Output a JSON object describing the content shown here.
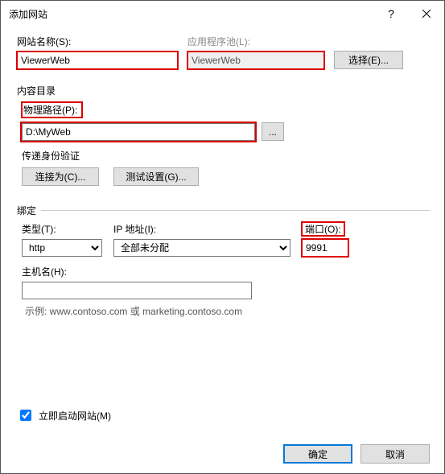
{
  "titlebar": {
    "title": "添加网站",
    "help": "?",
    "close": "×"
  },
  "site": {
    "name_label": "网站名称(S):",
    "name_value": "ViewerWeb",
    "app_pool_label": "应用程序池(L):",
    "app_pool_value": "ViewerWeb",
    "select_btn": "选择(E)..."
  },
  "content_dir": {
    "group": "内容目录",
    "path_label": "物理路径(P):",
    "path_value": "D:\\MyWeb",
    "browse": "...",
    "auth_label": "传递身份验证",
    "connect_as": "连接为(C)...",
    "test": "测试设置(G)..."
  },
  "binding": {
    "group": "绑定",
    "type_label": "类型(T):",
    "type_value": "http",
    "ip_label": "IP 地址(I):",
    "ip_value": "全部未分配",
    "port_label": "端口(O):",
    "port_value": "9991",
    "host_label": "主机名(H):",
    "host_value": "",
    "example": "示例: www.contoso.com 或 marketing.contoso.com"
  },
  "start": {
    "label": "立即启动网站(M)"
  },
  "footer": {
    "ok": "确定",
    "cancel": "取消"
  }
}
